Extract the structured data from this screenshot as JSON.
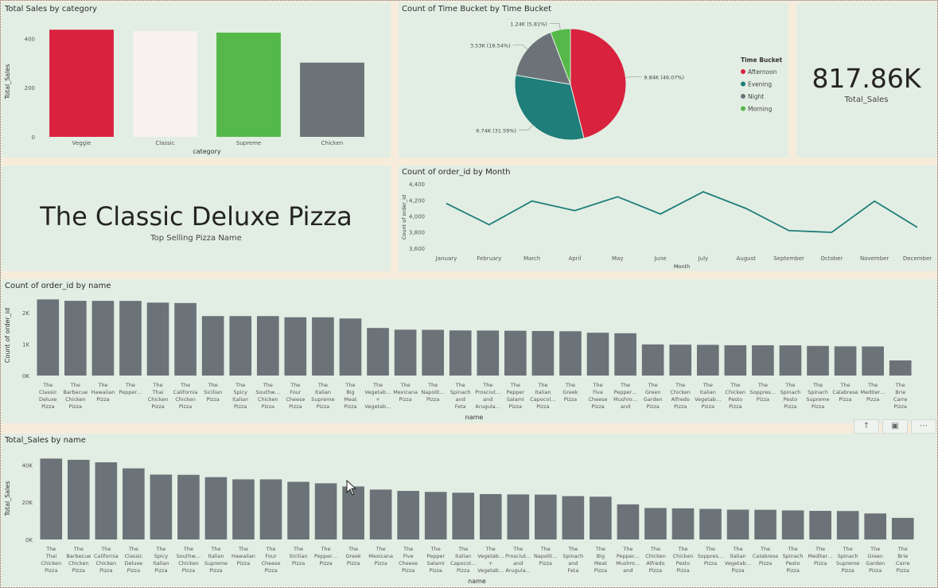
{
  "colors": {
    "page_bg": "#f7ecdb",
    "panel_bg": "#e2eee4",
    "bar_gray": "#6b7378",
    "red": "#d9223e",
    "white_bar": "#f8f2f2",
    "green": "#54b948",
    "teal": "#1f7d7a",
    "line_teal": "#1f7d7a"
  },
  "kpi_sales": {
    "value": "817.86K",
    "label": "Total_Sales"
  },
  "kpi_pizza": {
    "value": "The Classic Deluxe Pizza",
    "label": "Top Selling Pizza Name"
  },
  "chart_data": [
    {
      "id": "sales_by_category",
      "type": "bar",
      "title": "Total Sales by category",
      "xlabel": "category",
      "ylabel": "Total_Sales",
      "ylim": [
        0,
        450
      ],
      "yticks": [
        0,
        200,
        400
      ],
      "ytick_labels": [
        "0",
        "200",
        "400"
      ],
      "categories": [
        "Veggie",
        "Classic",
        "Supreme",
        "Chicken"
      ],
      "values": [
        436,
        430,
        424,
        302
      ],
      "colors": [
        "#d9223e",
        "#f8f2f2",
        "#54b948",
        "#6b7378"
      ]
    },
    {
      "id": "time_bucket_pie",
      "type": "pie",
      "title": "Count of Time Bucket by Time Bucket",
      "legend_title": "Time Bucket",
      "legend_position": "right",
      "slices": [
        {
          "name": "Afternoon",
          "value": 9840,
          "label": "9.84K (46.07%)",
          "color": "#d9223e"
        },
        {
          "name": "Evening",
          "value": 6740,
          "label": "6.74K (31.59%)",
          "color": "#1f7d7a"
        },
        {
          "name": "Night",
          "value": 3530,
          "label": "3.53K (16.54%)",
          "color": "#6b7378"
        },
        {
          "name": "Morning",
          "value": 1240,
          "label": "1.24K (5.81%)",
          "color": "#54b948"
        }
      ]
    },
    {
      "id": "orders_by_month",
      "type": "line",
      "title": "Count of order_id by Month",
      "xlabel": "Month",
      "ylabel": "Count of order_id",
      "ylim": [
        3550,
        4420
      ],
      "yticks": [
        3600,
        3800,
        4000,
        4200,
        4400
      ],
      "ytick_labels": [
        "3,600",
        "3,800",
        "4,000",
        "4,200",
        "4,400"
      ],
      "x": [
        "January",
        "February",
        "March",
        "April",
        "May",
        "June",
        "July",
        "August",
        "September",
        "October",
        "November",
        "December"
      ],
      "values": [
        4156,
        3892,
        4186,
        4067,
        4239,
        4025,
        4301,
        4094,
        3819,
        3797,
        4185,
        3859
      ],
      "color": "#1f7d7a"
    },
    {
      "id": "orders_by_name",
      "type": "bar",
      "title": "Count of order_id by name",
      "xlabel": "name",
      "ylabel": "Count of order_id",
      "ylim": [
        0,
        2550
      ],
      "yticks": [
        0,
        1000,
        2000
      ],
      "ytick_labels": [
        "0K",
        "1K",
        "2K"
      ],
      "categories": [
        "The Classic Deluxe Pizza",
        "The Barbecue Chicken Pizza",
        "The Hawaiian Pizza",
        "The Pepper…",
        "The Thai Chicken Pizza",
        "The California Chicken Pizza",
        "The Sicilian Pizza",
        "The Spicy Italian Pizza",
        "The Southw… Chicken Pizza",
        "The Four Cheese Pizza",
        "The Italian Supreme Pizza",
        "The Big Meat Pizza",
        "The Vegetab… + Vegetab…",
        "The Mexicana Pizza",
        "The Napolit… Pizza",
        "The Spinach and Feta Pizza",
        "The Prosciut… and Arugula…",
        "The Pepper Salami Pizza",
        "The Italian Capocol… Pizza",
        "The Greek Pizza",
        "The Five Cheese Pizza",
        "The Pepper… Mushro… and Pep…",
        "The Green Garden Pizza",
        "The Chicken Alfredo Pizza",
        "The Italian Vegetab… Pizza",
        "The Chicken Pesto Pizza",
        "The Soppres… Pizza",
        "The Spinach Pesto Pizza",
        "The Spinach Supreme Pizza",
        "The Calabrese Pizza",
        "The Mediter… Pizza",
        "The Brie Carre Pizza"
      ],
      "values": [
        2416,
        2372,
        2370,
        2369,
        2315,
        2302,
        1887,
        1887,
        1887,
        1850,
        1849,
        1811,
        1510,
        1456,
        1451,
        1432,
        1428,
        1422,
        1414,
        1406,
        1359,
        1342,
        987,
        980,
        975,
        961,
        961,
        957,
        940,
        927,
        923,
        480
      ]
    },
    {
      "id": "sales_by_name",
      "type": "bar",
      "title": "Total_Sales by name",
      "xlabel": "name",
      "ylabel": "Total_Sales",
      "ylim": [
        0,
        44000
      ],
      "yticks": [
        0,
        20000,
        40000
      ],
      "ytick_labels": [
        "0K",
        "20K",
        "40K"
      ],
      "categories": [
        "The Thai Chicken Pizza",
        "The Barbecue Chicken Pizza",
        "The California Chicken Pizza",
        "The Classic Deluxe Pizza",
        "The Spicy Italian Pizza",
        "The Southw… Chicken Pizza",
        "The Italian Supreme Pizza",
        "The Hawaiian Pizza",
        "The Four Cheese Pizza",
        "The Sicilian Pizza",
        "The Pepper… Pizza",
        "The Greek Pizza",
        "The Mexicana Pizza",
        "The Five Cheese Pizza",
        "The Pepper Salami Pizza",
        "The Italian Capocol… Pizza",
        "The Vegetab… + Vegetab…",
        "The Prosciut… and Arugula…",
        "The Napolit… Pizza",
        "The Spinach and Feta Pizza",
        "The Big Meat Pizza",
        "The Pepper… Mushro… and Pep…",
        "The Chicken Alfredo Pizza",
        "The Chicken Pesto Pizza",
        "The Soppres… Pizza",
        "The Italian Vegetab… Pizza",
        "The Calabrese Pizza",
        "The Spinach Pesto Pizza",
        "The Mediter… Pizza",
        "The Spinach Supreme Pizza",
        "The Green Garden Pizza",
        "The Brie Carre Pizza"
      ],
      "values": [
        43434,
        42768,
        41410,
        38180,
        34832,
        34706,
        33477,
        32273,
        32265,
        30940,
        30162,
        28454,
        26781,
        26066,
        25529,
        25095,
        24374,
        24193,
        24087,
        23271,
        22968,
        18834,
        16901,
        16702,
        16426,
        16019,
        15935,
        15597,
        15361,
        15278,
        13956,
        11589
      ]
    }
  ]
}
